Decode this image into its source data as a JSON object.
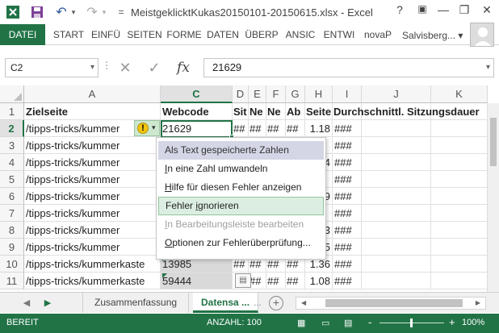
{
  "window": {
    "title": "MeistgeklicktKukas20150101-20150615.xlsx - Excel",
    "help": "?",
    "minimize": "—",
    "restore": "❐",
    "close": "✕"
  },
  "quick_access": {
    "undo": "↶",
    "redo": "↷",
    "more": "="
  },
  "ribbon": {
    "tabs": [
      "DATEI",
      "START",
      "EINFÜ",
      "SEITEN",
      "FORME",
      "DATEN",
      "ÜBERP",
      "ANSIC",
      "ENTWI",
      "novaP"
    ],
    "user": "Salvisberg...",
    "user_arrow": "▾"
  },
  "formula_bar": {
    "name_box": "C2",
    "dots": "⋮",
    "cancel": "✕",
    "enter": "✓",
    "fx": "fx",
    "value": "21629"
  },
  "grid": {
    "columns": [
      "A",
      "C",
      "D",
      "E",
      "F",
      "G",
      "H",
      "I",
      "J",
      "K"
    ],
    "selected_column": "C",
    "rows": [
      {
        "num": "1",
        "a": "Zielseite",
        "c": "Webcode",
        "d": "Sit",
        "e": "Ne",
        "f": "Ne",
        "g": "Ab",
        "h": "Seite",
        "i": "Durchschnittl. Sitzungsdauer"
      },
      {
        "num": "2",
        "a": "/tipps-tricks/kummer",
        "c": "21629",
        "d": "##",
        "e": "##",
        "f": "##",
        "g": "##",
        "h": "1.18",
        "i": "###"
      },
      {
        "num": "3",
        "a": "/tipps-tricks/kummer",
        "c": "",
        "d": "",
        "e": "",
        "f": "",
        "g": "",
        "h": "",
        "i": "###"
      },
      {
        "num": "4",
        "a": "/tipps-tricks/kummer",
        "c": "",
        "d": "",
        "e": "",
        "f": "",
        "g": "",
        "h": "4",
        "i": "###"
      },
      {
        "num": "5",
        "a": "/tipps-tricks/kummer",
        "c": "",
        "d": "",
        "e": "",
        "f": "",
        "g": "",
        "h": "",
        "i": "###"
      },
      {
        "num": "6",
        "a": "/tipps-tricks/kummer",
        "c": "",
        "d": "",
        "e": "",
        "f": "",
        "g": "",
        "h": "9",
        "i": "###"
      },
      {
        "num": "7",
        "a": "/tipps-tricks/kummer",
        "c": "",
        "d": "",
        "e": "",
        "f": "",
        "g": "",
        "h": "",
        "i": "###"
      },
      {
        "num": "8",
        "a": "/tipps-tricks/kummer",
        "c": "",
        "d": "",
        "e": "",
        "f": "",
        "g": "",
        "h": "3",
        "i": "###"
      },
      {
        "num": "9",
        "a": "/tipps-tricks/kummer",
        "c": "",
        "d": "",
        "e": "",
        "f": "",
        "g": "",
        "h": "5",
        "i": "###"
      },
      {
        "num": "10",
        "a": "/tipps-tricks/kummerkaste",
        "c": "13985",
        "d": "##",
        "e": "##",
        "f": "##",
        "g": "##",
        "h": "1.36",
        "i": "###"
      },
      {
        "num": "11",
        "a": "/tipps-tricks/kummerkaste",
        "c": "59444",
        "d": "",
        "e": "##",
        "f": "##",
        "g": "##",
        "h": "1.08",
        "i": "###"
      }
    ]
  },
  "context_menu": {
    "header": "Als Text gespeicherte Zahlen",
    "items": [
      {
        "pre": "",
        "u": "I",
        "post": "n eine Zahl umwandeln"
      },
      {
        "pre": "",
        "u": "H",
        "post": "ilfe für diesen Fehler anzeigen"
      },
      {
        "pre": "Fehler ",
        "u": "i",
        "post": "gnorieren"
      },
      {
        "pre": "",
        "u": "I",
        "post": "n Bearbeitungsleiste bearbeiten"
      },
      {
        "pre": "",
        "u": "O",
        "post": "ptionen zur Fehlerüberprüfung..."
      }
    ]
  },
  "smart_tag": {
    "symbol": "!",
    "arrow": "▾"
  },
  "sheets": {
    "nav_prev": "◀",
    "nav_next": "▶",
    "tabs": [
      "Zusammenfassung",
      "Datensa ..."
    ],
    "more": "...",
    "add": "+"
  },
  "status_bar": {
    "mode": "BEREIT",
    "count": "ANZAHL: 100",
    "zoom_minus": "-",
    "zoom_plus": "+",
    "zoom": "100%"
  },
  "colors": {
    "accent": "#217346",
    "menu_header": "#d4d6e6",
    "menu_hover": "#dceee2"
  }
}
